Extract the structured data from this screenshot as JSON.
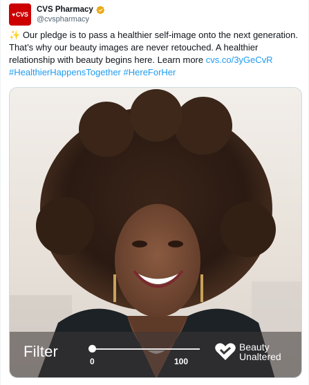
{
  "account": {
    "name": "CVS Pharmacy",
    "handle": "@cvspharmacy",
    "avatar_text": "CVS",
    "brand_color": "#cc0000",
    "verified_badge_color": "#e8a818"
  },
  "tweet": {
    "emoji": "✨",
    "text_part1": "Our pledge is to pass a healthier self-image onto the next generation. That’s why our beauty images are never retouched. A healthier relationship with beauty begins here. Learn more ",
    "link": "cvs.co/3yGeCvR",
    "hashtag1": "#HealthierHappensTogether",
    "hashtag2": "#HereForHer",
    "link_color": "#1d9bf0"
  },
  "media": {
    "filter_label": "Filter",
    "slider_min": "0",
    "slider_max": "100",
    "slider_value": 0,
    "brand_line1": "Beauty",
    "brand_line2": "Unaltered"
  }
}
